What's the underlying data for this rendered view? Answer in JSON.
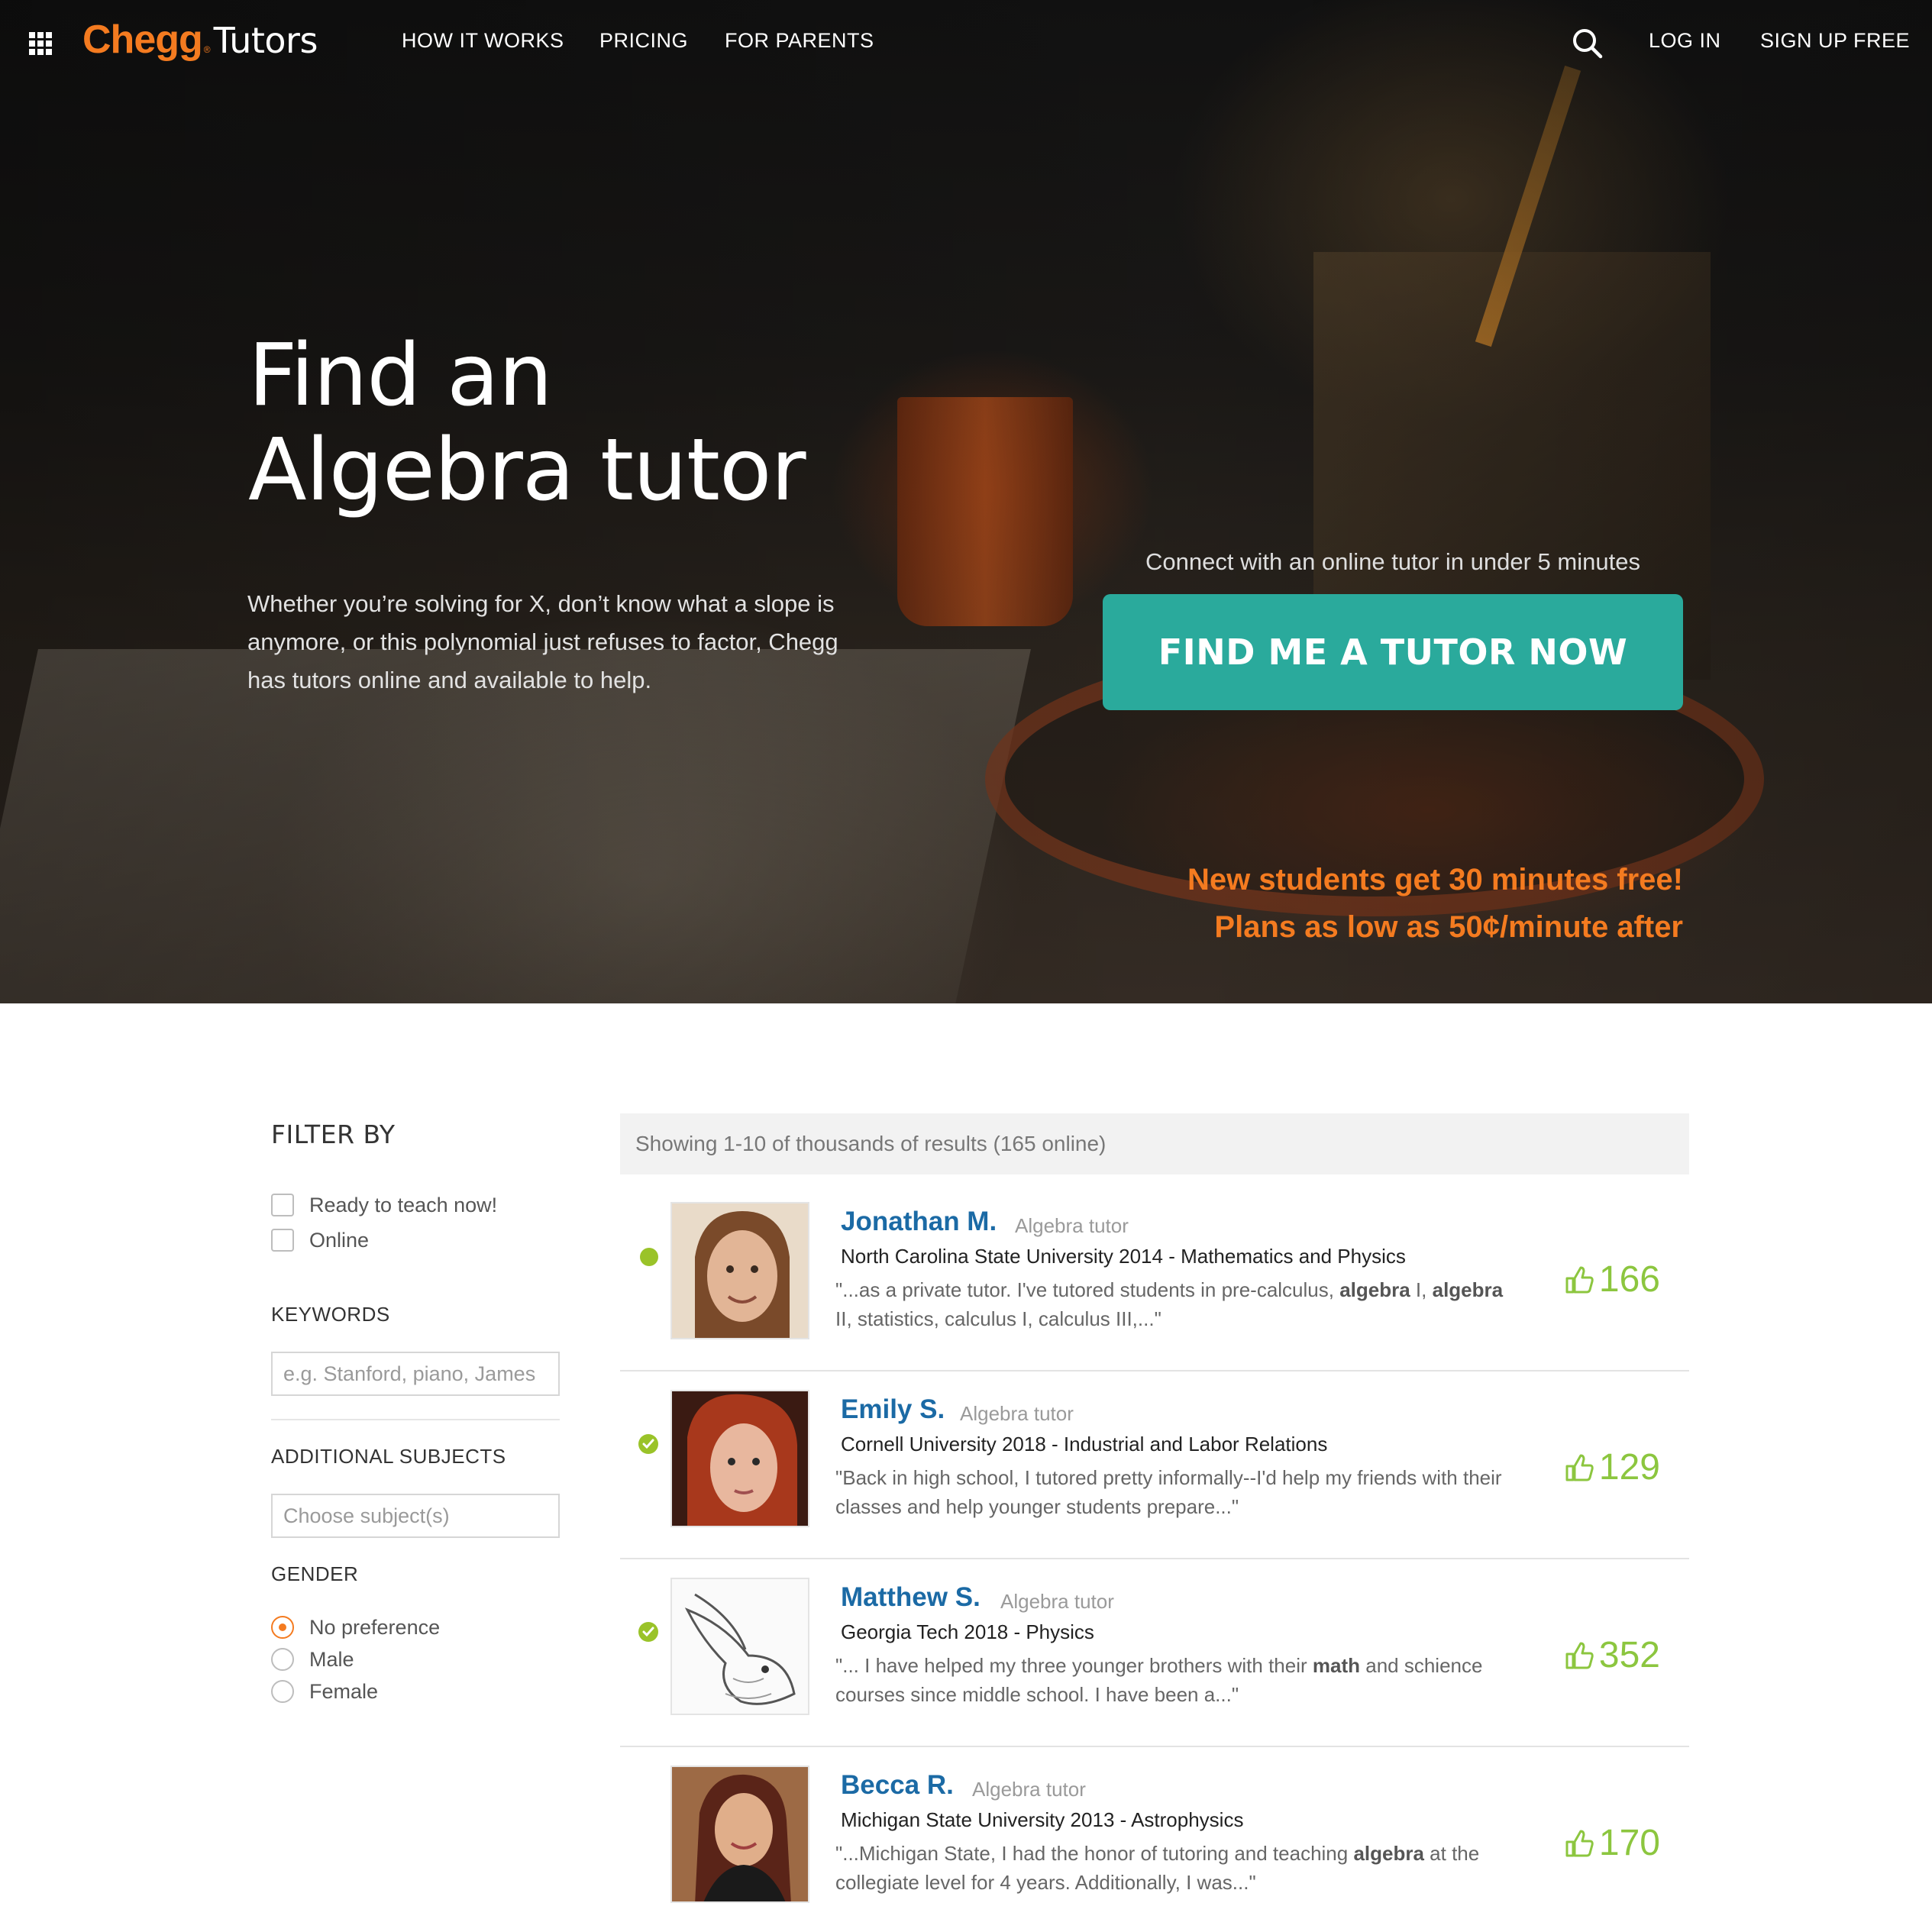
{
  "nav": {
    "logo_brand": "Chegg",
    "logo_reg": "®",
    "logo_product": "Tutors",
    "links": [
      "HOW IT WORKS",
      "PRICING",
      "FOR PARENTS"
    ],
    "login": "LOG IN",
    "signup": "SIGN UP FREE"
  },
  "hero": {
    "title_line1": "Find an",
    "title_line2": "Algebra tutor",
    "description": "Whether you’re solving for X, don’t know what a slope is anymore, or this polynomial just refuses to factor, Chegg has tutors online and available to help.",
    "cta_caption": "Connect with an online tutor in under 5 minutes",
    "cta_button": "FIND ME A TUTOR NOW",
    "promo_line1": "New students get 30 minutes free!",
    "promo_line2": "Plans as low as 50¢/minute after"
  },
  "filter": {
    "title": "FILTER BY",
    "checkboxes": [
      "Ready to teach now!",
      "Online"
    ],
    "keywords_label": "KEYWORDS",
    "keywords_placeholder": "e.g. Stanford, piano, James",
    "subjects_label": "ADDITIONAL SUBJECTS",
    "subjects_placeholder": "Choose subject(s)",
    "gender_label": "GENDER",
    "gender_options": [
      "No preference",
      "Male",
      "Female"
    ],
    "gender_selected": "No preference"
  },
  "results": {
    "summary": "Showing 1-10 of thousands of results (165 online)",
    "tutors": [
      {
        "name": "Jonathan M.",
        "role": "Algebra tutor",
        "school": "North Carolina State University 2014 - Mathematics and Physics",
        "quote": "\"...as a private tutor. I've tutored students in pre-calculus, <b>algebra</b> I, <b>algebra</b> II, statistics, calculus I, calculus III,...\"",
        "likes": "166",
        "status": "online"
      },
      {
        "name": "Emily S.",
        "role": "Algebra tutor",
        "school": "Cornell University 2018 - Industrial and Labor Relations",
        "quote": "\"Back in high school, I tutored pretty informally--I'd help my friends with their classes and help younger students prepare...\"",
        "likes": "129",
        "status": "ready"
      },
      {
        "name": "Matthew S.",
        "role": "Algebra tutor",
        "school": "Georgia Tech 2018 - Physics",
        "quote": "\"... I have helped my three younger brothers with their <b>math</b> and schience courses since middle school. I have been a...\"",
        "likes": "352",
        "status": "ready"
      },
      {
        "name": "Becca R.",
        "role": "Algebra tutor",
        "school": "Michigan State University 2013 - Astrophysics",
        "quote": "\"...Michigan State, I had the honor of tutoring and teaching <b>algebra</b> at the collegiate level for 4 years. Additionally, I was...\"",
        "likes": "170",
        "status": "none"
      }
    ]
  },
  "colors": {
    "brand_orange": "#f47b20",
    "cta_teal": "#2aaa9c",
    "name_blue": "#1b6aa5",
    "like_green": "#8cc63f",
    "online_green": "#9ac329"
  },
  "icons": [
    "app-grid-icon",
    "search-icon",
    "checkmark-icon",
    "thumbs-up-icon"
  ]
}
